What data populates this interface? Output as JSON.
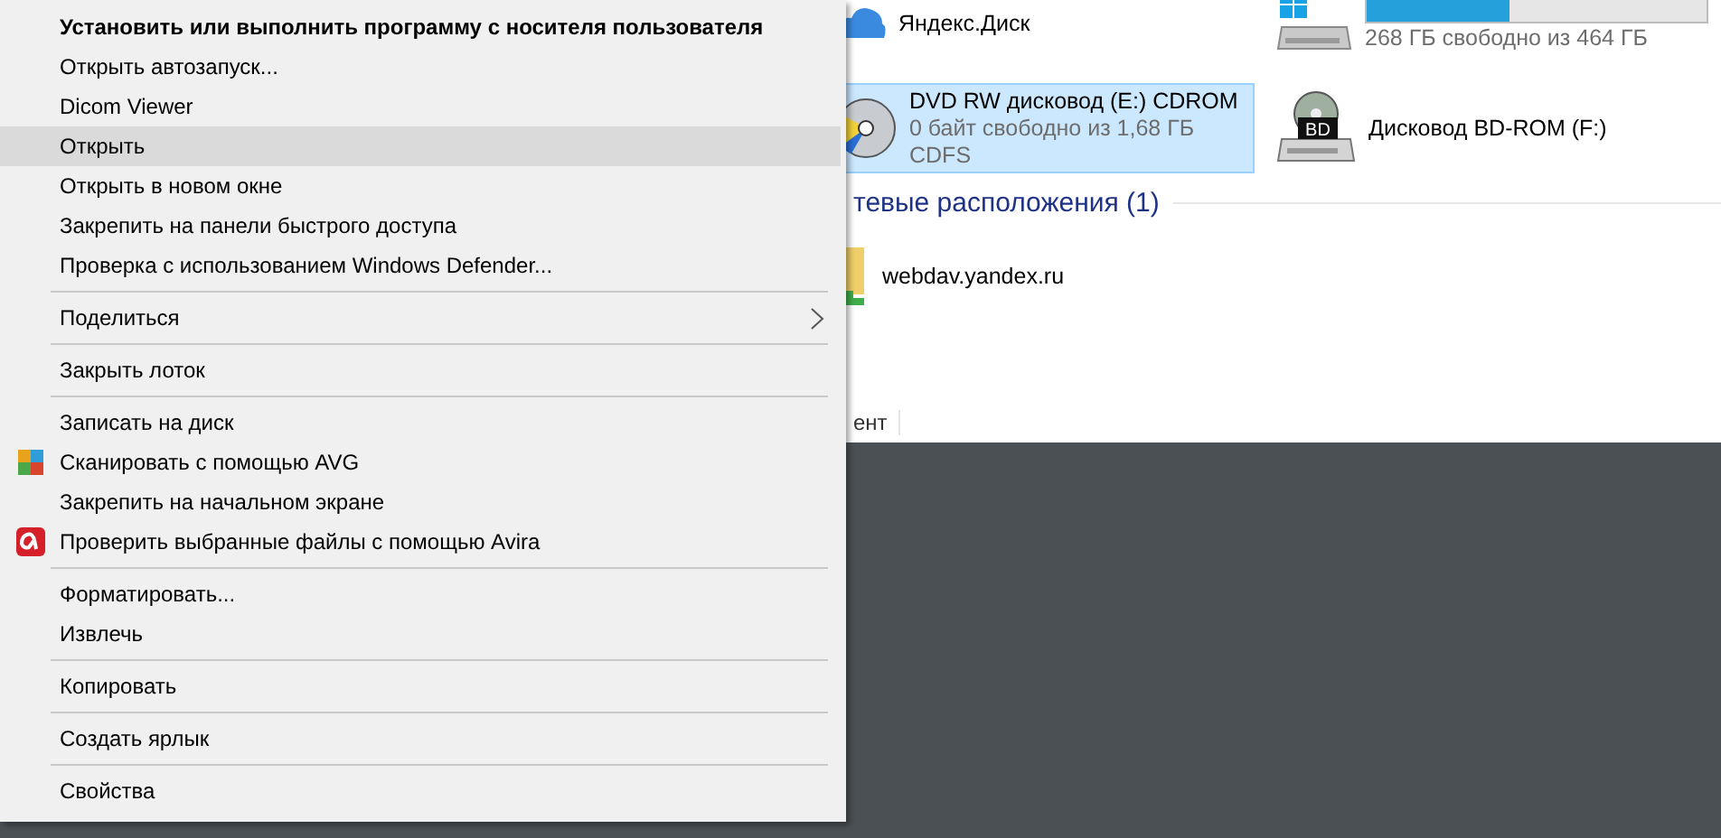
{
  "explorer": {
    "drives": [
      {
        "kind": "cloud",
        "name": "Яндекс.Диск",
        "selected": false
      },
      {
        "kind": "system",
        "free": "268 ГБ свободно из 464 ГБ",
        "level": 0.42,
        "selected": false
      },
      {
        "kind": "dvd",
        "name": "DVD RW дисковод (E:) CDROM",
        "free": "0 байт свободно из 1,68 ГБ",
        "fs": "CDFS",
        "selected": true
      },
      {
        "kind": "bd",
        "name": "Дисковод BD-ROM (F:)",
        "badge": "BD",
        "selected": false
      }
    ],
    "network_header": "тевые расположения (1)",
    "network_items": [
      {
        "name": "webdav.yandex.ru"
      }
    ],
    "status_bar": "ент"
  },
  "context_menu": {
    "items": [
      {
        "kind": "item",
        "label": "Установить или выполнить программу с носителя пользователя",
        "bold": true,
        "selected": false
      },
      {
        "kind": "item",
        "label": "Открыть автозапуск...",
        "bold": false,
        "selected": false
      },
      {
        "kind": "item",
        "label": "Dicom Viewer",
        "bold": false,
        "selected": false
      },
      {
        "kind": "item",
        "label": "Открыть",
        "bold": false,
        "selected": true
      },
      {
        "kind": "item",
        "label": "Открыть в новом окне",
        "bold": false,
        "selected": false
      },
      {
        "kind": "item",
        "label": "Закрепить на панели быстрого доступа",
        "bold": false,
        "selected": false
      },
      {
        "kind": "item",
        "label": "Проверка с использованием Windows Defender...",
        "bold": false,
        "selected": false
      },
      {
        "kind": "separator"
      },
      {
        "kind": "submenu",
        "label": "Поделиться",
        "bold": false,
        "selected": false
      },
      {
        "kind": "separator"
      },
      {
        "kind": "item",
        "label": "Закрыть лоток",
        "bold": false,
        "selected": false
      },
      {
        "kind": "separator"
      },
      {
        "kind": "item",
        "label": "Записать на диск",
        "bold": false,
        "selected": false
      },
      {
        "kind": "tiles-icon-item",
        "label": "Сканировать с помощью AVG",
        "bold": false,
        "selected": false
      },
      {
        "kind": "item",
        "label": "Закрепить на начальном экране",
        "bold": false,
        "selected": false
      },
      {
        "kind": "badge-icon-item",
        "label": "Проверить выбранные файлы с помощью Avira",
        "bold": false,
        "selected": false
      },
      {
        "kind": "separator"
      },
      {
        "kind": "item",
        "label": "Форматировать...",
        "bold": false,
        "selected": false
      },
      {
        "kind": "item",
        "label": "Извлечь",
        "bold": false,
        "selected": false
      },
      {
        "kind": "separator"
      },
      {
        "kind": "item",
        "label": "Копировать",
        "bold": false,
        "selected": false
      },
      {
        "kind": "separator"
      },
      {
        "kind": "item",
        "label": "Создать ярлык",
        "bold": false,
        "selected": false
      },
      {
        "kind": "separator"
      },
      {
        "kind": "item",
        "label": "Свойства",
        "bold": false,
        "selected": false
      }
    ]
  }
}
